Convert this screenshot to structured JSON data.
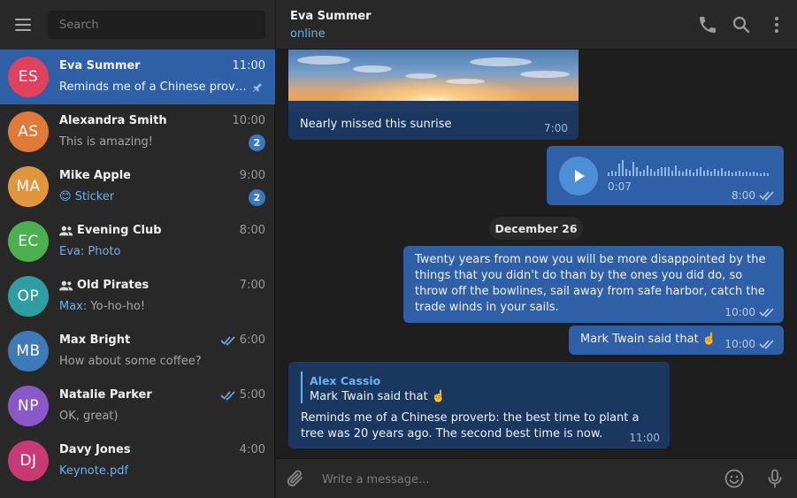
{
  "sidebar": {
    "search_placeholder": "Search",
    "chats": [
      {
        "initials": "ES",
        "name": "Eva Summer",
        "time": "11:00",
        "preview": "Reminds me of a Chinese proverb: the best time to plant a tree was 20 years ago.",
        "avatar_color": "#e0415c",
        "pinned": true,
        "active": true
      },
      {
        "initials": "AS",
        "name": "Alexandra Smith",
        "time": "10:00",
        "preview": "This is amazing!",
        "avatar_color": "#e07a3a",
        "badge": "2"
      },
      {
        "initials": "MA",
        "name": "Mike Apple",
        "time": "9:00",
        "preview_emoji": "😊",
        "preview": "Sticker",
        "avatar_color": "#e0963c",
        "badge": "2"
      },
      {
        "initials": "EC",
        "name": "Evening Club",
        "time": "8:00",
        "sender": "Eva:",
        "preview": "Photo",
        "avatar_color": "#4caf50",
        "group": true
      },
      {
        "initials": "OP",
        "name": "Old Pirates",
        "time": "7:00",
        "sender": "Max:",
        "preview": "Yo-ho-ho!",
        "avatar_color": "#2e9ea3",
        "group": true
      },
      {
        "initials": "MB",
        "name": "Max Bright",
        "time": "6:00",
        "preview": "How about some coffee?",
        "avatar_color": "#3e7ab8",
        "read": true
      },
      {
        "initials": "NP",
        "name": "Natalie Parker",
        "time": "5:00",
        "preview": "OK, great)",
        "avatar_color": "#8a58c9",
        "read": true
      },
      {
        "initials": "DJ",
        "name": "Davy Jones",
        "time": "4:00",
        "preview": "Keynote.pdf",
        "avatar_color": "#c93a74"
      }
    ]
  },
  "header": {
    "name": "Eva Summer",
    "status": "online"
  },
  "messages": {
    "photo_caption": "Nearly missed this sunrise",
    "photo_time": "7:00",
    "voice_duration": "0:07",
    "voice_time": "8:00",
    "date_divider": "December 26",
    "long_text": "Twenty years from now you will be more disappointed by the things that you didn't do than by the ones you did do, so throw off the bowlines, sail away from safe harbor, catch the trade winds in your sails.",
    "long_time": "10:00",
    "short_text": "Mark Twain said that ☝️",
    "short_time": "10:00",
    "reply_author": "Alex Cassio",
    "reply_quote": "Mark Twain said that ☝️",
    "reply_text": "Reminds me of a Chinese proverb: the best time to plant a tree was 20 years ago. The second best time is now.",
    "reply_time": "11:00"
  },
  "composer": {
    "placeholder": "Write a message..."
  },
  "colors": {
    "accent": "#2f5fa6",
    "link": "#6ab2f2",
    "incoming": "#19375f",
    "badge": "#3a78c1"
  }
}
